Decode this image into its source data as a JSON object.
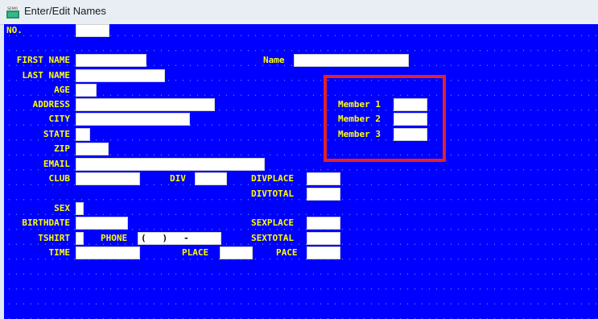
{
  "window": {
    "title": "Enter/Edit Names",
    "icon": "app-icon",
    "accent": "#0000ff",
    "label_color": "#ffff00",
    "highlight_color": "#e02424"
  },
  "labels": {
    "no": "NO.",
    "first_name": "FIRST NAME",
    "name": "Name",
    "last_name": "LAST NAME",
    "age": "AGE",
    "address": "ADDRESS",
    "city": "CITY",
    "state": "STATE",
    "zip": "ZIP",
    "email": "EMAIL",
    "club": "CLUB",
    "div": "DIV",
    "divplace": "DIVPLACE",
    "divtotal": "DIVTOTAL",
    "sex": "SEX",
    "birthdate": "BIRTHDATE",
    "sexplace": "SEXPLACE",
    "tshirt": "TSHIRT",
    "phone": "PHONE",
    "sextotal": "SEXTOTAL",
    "time": "TIME",
    "place": "PLACE",
    "pace": "PACE",
    "member1": "Member 1",
    "member2": "Member 2",
    "member3": "Member 3"
  },
  "values": {
    "phone": "(   )   -"
  }
}
